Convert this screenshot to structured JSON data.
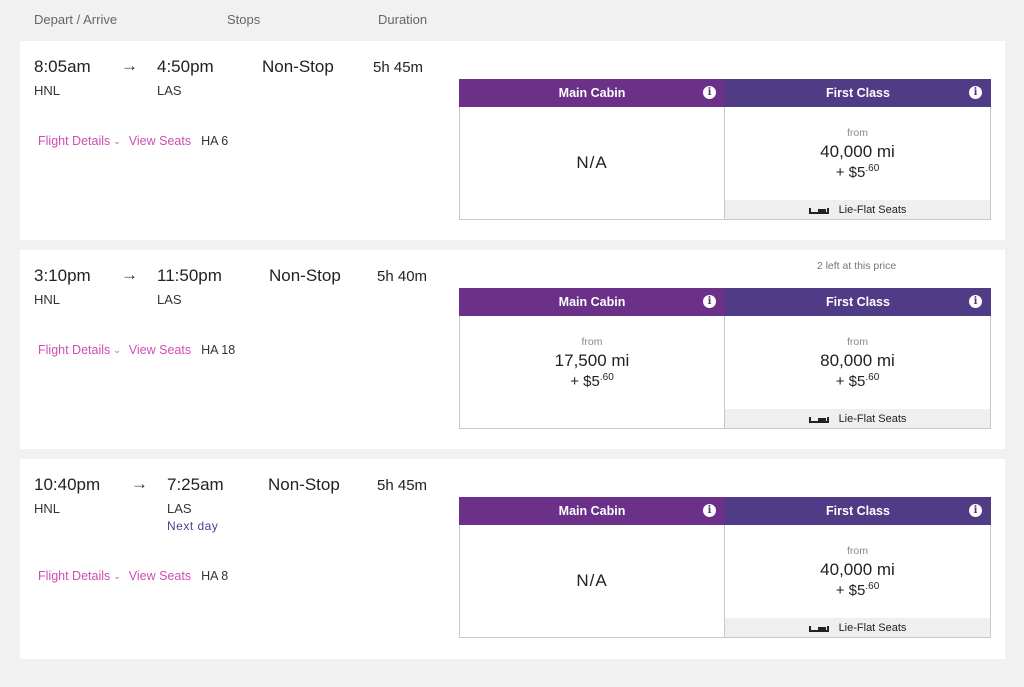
{
  "columns": {
    "depart_arrive": "Depart / Arrive",
    "stops": "Stops",
    "duration": "Duration"
  },
  "colors": {
    "main_cabin_header": "#6b3088",
    "first_class_header": "#4f3b86",
    "link": "#d14db5",
    "next_day": "#4e3d8f"
  },
  "flights": [
    {
      "depart_time": "8:05am",
      "arrow": "→",
      "arrive_time": "4:50pm",
      "origin": "HNL",
      "destination": "LAS",
      "next_day": "",
      "stops": "Non-Stop",
      "duration": "5h 45m",
      "flight_details_label": "Flight Details",
      "chevron": "⌄",
      "view_seats_label": "View Seats",
      "flight_number": "HA 6",
      "availability_note": "",
      "main_cabin": {
        "label": "Main Cabin",
        "info_icon": "i",
        "available": false,
        "na_text": "N/A",
        "from": "",
        "miles": "",
        "tax_prefix": "",
        "tax_cents": ""
      },
      "first_class": {
        "label": "First Class",
        "info_icon": "i",
        "available": true,
        "from": "from",
        "miles": "40,000 mi",
        "tax_prefix": "+ $5",
        "tax_cents": ".60",
        "feature": "Lie-Flat Seats",
        "feature_icon": "bed-icon"
      }
    },
    {
      "depart_time": "3:10pm",
      "arrow": "→",
      "arrive_time": "11:50pm",
      "origin": "HNL",
      "destination": "LAS",
      "next_day": "",
      "stops": "Non-Stop",
      "duration": "5h 40m",
      "flight_details_label": "Flight Details",
      "chevron": "⌄",
      "view_seats_label": "View Seats",
      "flight_number": "HA 18",
      "availability_note": "2 left at this price",
      "main_cabin": {
        "label": "Main Cabin",
        "info_icon": "i",
        "available": true,
        "na_text": "",
        "from": "from",
        "miles": "17,500 mi",
        "tax_prefix": "+ $5",
        "tax_cents": ".60"
      },
      "first_class": {
        "label": "First Class",
        "info_icon": "i",
        "available": true,
        "from": "from",
        "miles": "80,000 mi",
        "tax_prefix": "+ $5",
        "tax_cents": ".60",
        "feature": "Lie-Flat Seats",
        "feature_icon": "bed-icon"
      }
    },
    {
      "depart_time": "10:40pm",
      "arrow": "→",
      "arrive_time": "7:25am",
      "origin": "HNL",
      "destination": "LAS",
      "next_day": "Next day",
      "stops": "Non-Stop",
      "duration": "5h 45m",
      "flight_details_label": "Flight Details",
      "chevron": "⌄",
      "view_seats_label": "View Seats",
      "flight_number": "HA 8",
      "availability_note": "",
      "main_cabin": {
        "label": "Main Cabin",
        "info_icon": "i",
        "available": false,
        "na_text": "N/A",
        "from": "",
        "miles": "",
        "tax_prefix": "",
        "tax_cents": ""
      },
      "first_class": {
        "label": "First Class",
        "info_icon": "i",
        "available": true,
        "from": "from",
        "miles": "40,000 mi",
        "tax_prefix": "+ $5",
        "tax_cents": ".60",
        "feature": "Lie-Flat Seats",
        "feature_icon": "bed-icon"
      }
    }
  ]
}
